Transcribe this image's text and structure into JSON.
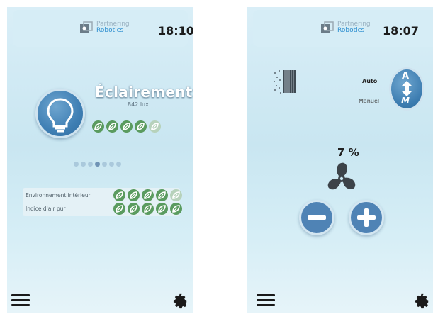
{
  "screens": [
    {
      "header": {
        "logo_line1": "Partnering",
        "logo_line2": "Robotics",
        "time": "18:10"
      },
      "lighting": {
        "title": "Éclairement",
        "value": "842 lux",
        "rating_filled": 4,
        "rating_total": 5
      },
      "pager": {
        "count": 7,
        "active_index": 3
      },
      "indices": [
        {
          "label": "Environnement intérieur",
          "rating_filled": 4,
          "rating_total": 5
        },
        {
          "label": "Indice d'air pur",
          "rating_filled": 5,
          "rating_total": 5
        }
      ],
      "icons": {
        "bulb": "lightbulb-icon",
        "menu": "hamburger-menu-icon",
        "settings": "gear-icon"
      }
    },
    {
      "header": {
        "logo_line1": "Partnering",
        "logo_line2": "Robotics",
        "time": "18:07"
      },
      "mode": {
        "auto_label": "Auto",
        "manual_label": "Manuel",
        "button_letters_top": "A",
        "button_letters_bottom": "M"
      },
      "fan": {
        "speed_percent": "7 %"
      },
      "icons": {
        "filter": "air-filter-icon",
        "fan": "fan-icon",
        "decrease": "minus-icon",
        "increase": "plus-icon",
        "menu": "hamburger-menu-icon",
        "settings": "gear-icon"
      }
    }
  ],
  "colors": {
    "accent_blue": "#4f83b5",
    "leaf_green": "#5a9b5f",
    "leaf_dim": "#b7d2bb",
    "bg_top": "#d9eef7"
  }
}
